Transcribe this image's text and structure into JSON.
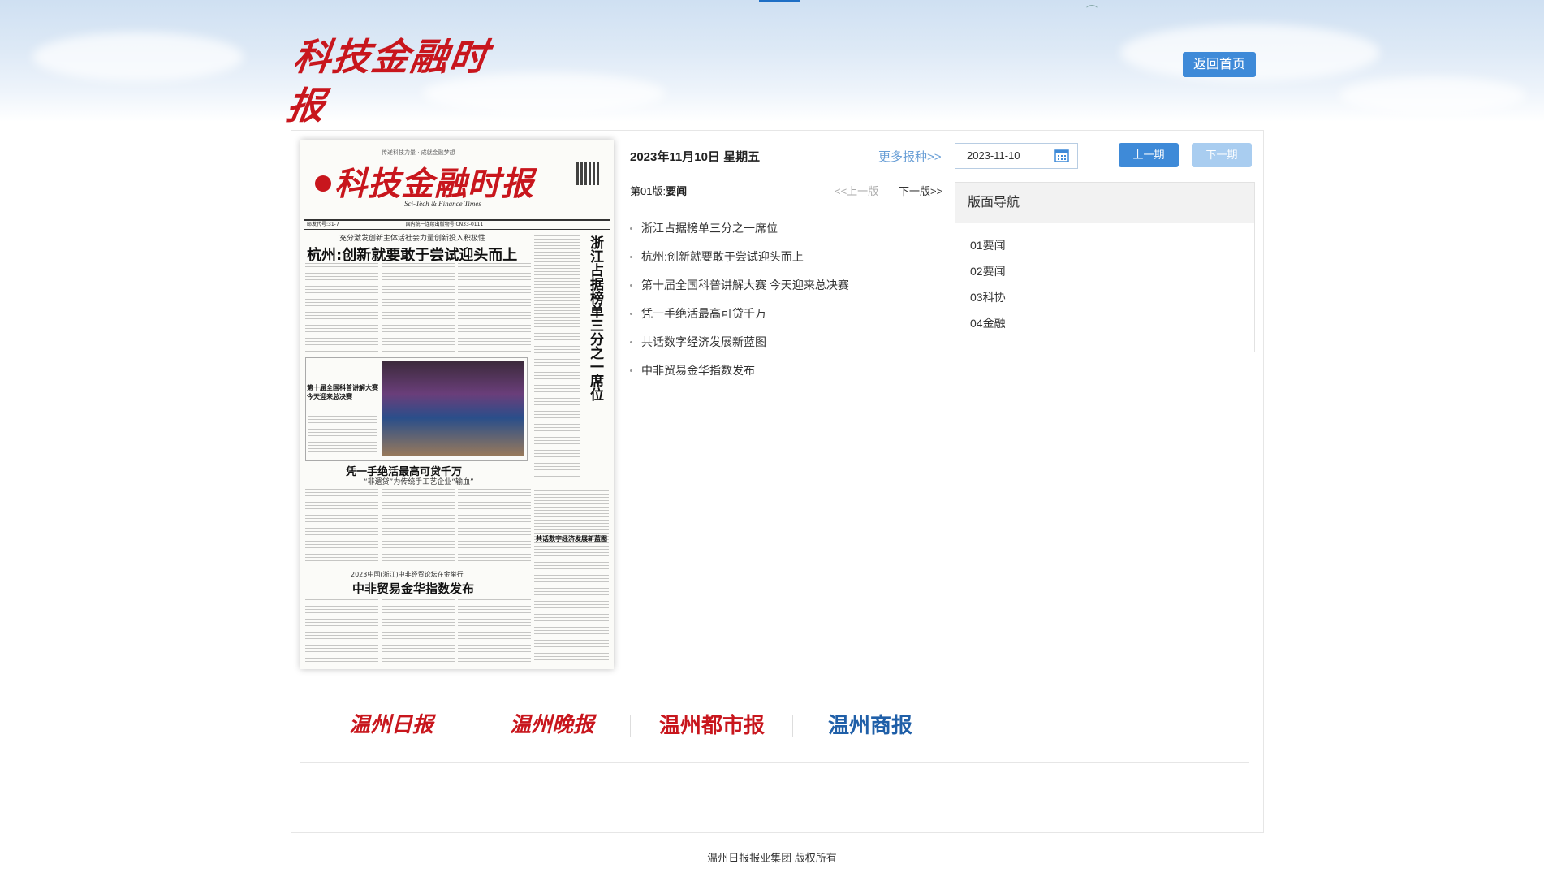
{
  "header": {
    "brand": "科技金融时报",
    "home_label": "返回首页"
  },
  "newspaper": {
    "slogan": "传递科技力量 · 成就金融梦想",
    "title": "科技金融时报",
    "subtitle": "Sci-Tech & Finance Times",
    "bar_text": "邮发代号:31-7",
    "bar_cn": "国内统一连续出版物号 CN33-0111",
    "headline_kicker": "充分激发创新主体活社会力量创新投入积极性",
    "headline": "杭州:创新就要敢于尝试迎头而上",
    "vertical_headline": "浙江占据榜单三分之一席位",
    "photo_caption": "第十届全国科普讲解大赛今天迎来总决赛",
    "h2": "凭一手绝活最高可贷千万",
    "h2_sub": "“非遗贷”为传统手工艺企业“输血”",
    "h3_kicker": "2023中国(浙江)中非经贸论坛在金举行",
    "h3": "中非贸易金华指数发布",
    "side_small": "共话数字经济发展新蓝图"
  },
  "issue": {
    "date_text": "2023年11月10日 星期五",
    "more_label": "更多报种>>",
    "date_value": "2023-11-10",
    "prev_issue": "上一期",
    "next_issue": "下一期"
  },
  "edition": {
    "label": "第01版:",
    "name": "要闻",
    "prev": "<<上一版",
    "next": "下一版>>"
  },
  "articles": [
    "浙江占据榜单三分之一席位",
    "杭州:创新就要敢于尝试迎头而上",
    "第十届全国科普讲解大赛 今天迎来总决赛",
    "凭一手绝活最高可贷千万",
    "共话数字经济发展新蓝图",
    "中非贸易金华指数发布"
  ],
  "nav": {
    "title": "版面导航",
    "items": [
      "01要闻",
      "02要闻",
      "03科协",
      "04金融"
    ]
  },
  "partners": [
    "温州日报",
    "温州晚报",
    "温州都市报",
    "温州商报"
  ],
  "footer": "温州日报报业集团 版权所有",
  "colors": {
    "brand_red": "#c8161d",
    "button_blue": "#3e8ad8",
    "button_disabled": "#a9cdf0",
    "link_blue": "#6a9fd6",
    "shangbao_blue": "#1f5fa8"
  }
}
